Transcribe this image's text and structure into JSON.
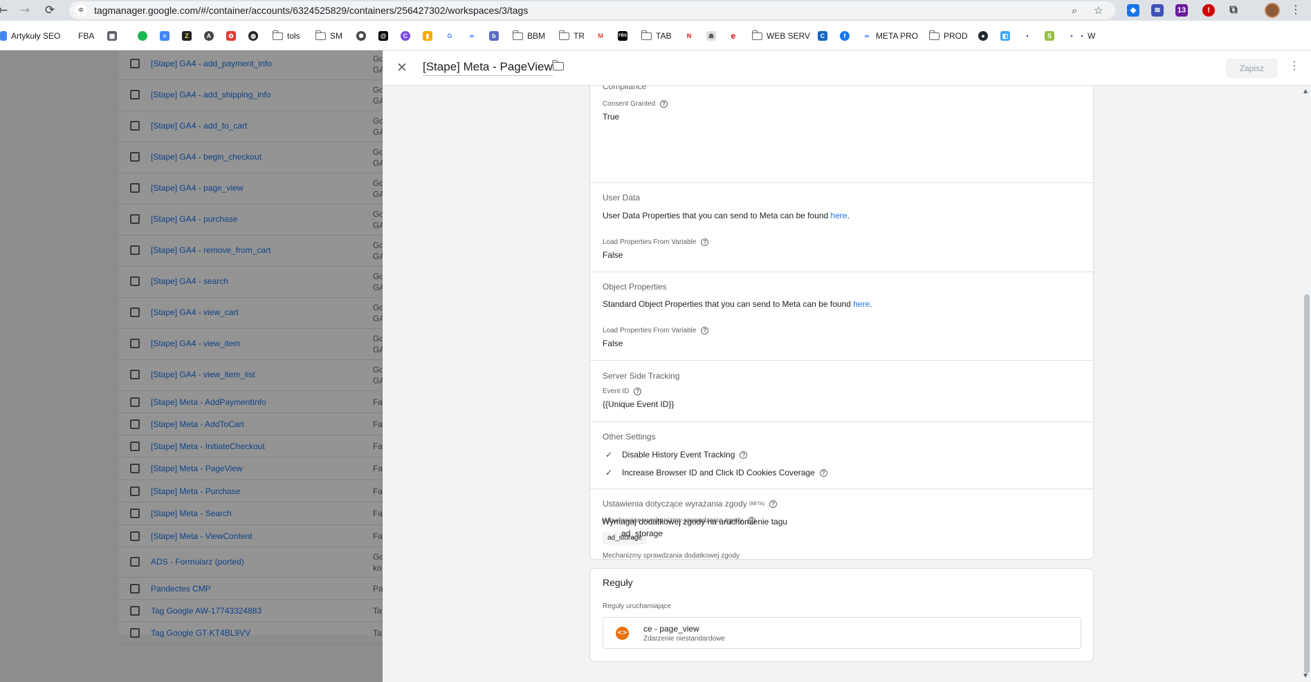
{
  "browser": {
    "url": "tagmanager.google.com/#/container/accounts/6324525829/containers/256427302/workspaces/3/tags",
    "extension_badge": "13"
  },
  "bookmarks": {
    "artykuly": "Artykuły SEO",
    "fba": "FBA",
    "tols": "tols",
    "sm": "SM",
    "bbm": "BBM",
    "tr": "TR",
    "tab": "TAB",
    "web_serv": "WEB SERV",
    "meta_pro": "META PRO",
    "prod": "PROD",
    "w": "W"
  },
  "tag_list": {
    "rows": [
      {
        "name": "[Stape] GA4 - add_payment_info",
        "type": "Go GA"
      },
      {
        "name": "[Stape] GA4 - add_shipping_info",
        "type": "Go GA"
      },
      {
        "name": "[Stape] GA4 - add_to_cart",
        "type": "Go GA"
      },
      {
        "name": "[Stape] GA4 - begin_checkout",
        "type": "Go GA"
      },
      {
        "name": "[Stape] GA4 - page_view",
        "type": "Go GA"
      },
      {
        "name": "[Stape] GA4 - purchase",
        "type": "Go GA"
      },
      {
        "name": "[Stape] GA4 - remove_from_cart",
        "type": "Go GA"
      },
      {
        "name": "[Stape] GA4 - search",
        "type": "Go GA"
      },
      {
        "name": "[Stape] GA4 - view_cart",
        "type": "Go GA"
      },
      {
        "name": "[Stape] GA4 - view_item",
        "type": "Go GA"
      },
      {
        "name": "[Stape] GA4 - view_item_list",
        "type": "Go GA"
      },
      {
        "name": "[Stape] Meta - AddPaymentInfo",
        "type": "Fa"
      },
      {
        "name": "[Stape] Meta - AddToCart",
        "type": "Fa"
      },
      {
        "name": "[Stape] Meta - InitiateCheckout",
        "type": "Fa"
      },
      {
        "name": "[Stape] Meta - PageView",
        "type": "Fa"
      },
      {
        "name": "[Stape] Meta - Purchase",
        "type": "Fa"
      },
      {
        "name": "[Stape] Meta - Search",
        "type": "Fa"
      },
      {
        "name": "[Stape] Meta - ViewContent",
        "type": "Fa"
      },
      {
        "name": "ADS - Formularz (ported)",
        "type": "Go ko"
      },
      {
        "name": "Pandectes CMP",
        "type": "Pa"
      },
      {
        "name": "Tag Google AW-17743324883",
        "type": "Ta"
      },
      {
        "name": "Tag Google GT-KT4BL9VV",
        "type": "Ta"
      }
    ]
  },
  "sheet": {
    "title": "[Stape] Meta - PageView",
    "save_label": "Zapisz"
  },
  "config": {
    "compliance_title": "Compliance",
    "consent_label": "Consent Granted",
    "consent_value": "True",
    "user_data_title": "User Data",
    "user_data_desc": "User Data Properties that you can send to Meta can be found ",
    "link_here": "here",
    "load_from_variable_label": "Load Properties From Variable",
    "user_data_load_value": "False",
    "object_props_title": "Object Properties",
    "object_props_desc": "Standard Object Properties that you can send to Meta can be found ",
    "object_props_load_value": "False",
    "sst_title": "Server Side Tracking",
    "event_id_label": "Event ID",
    "event_id_value": "{{Unique Event ID}}",
    "other_title": "Other Settings",
    "disable_history": "Disable History Event Tracking",
    "increase_cookies": "Increase Browser ID and Click ID Cookies Coverage",
    "consent_settings_title": "Ustawienia dotyczące wyrażania zgody",
    "beta": "(BETA)",
    "builtin_consent_label": "Wbudowane mechanizmy sprawdzania zgody",
    "builtin_chip": "ad_storage",
    "additional_consent_label": "Mechanizmy sprawdzania dodatkowej zgody",
    "additional_consent_value": "Wymagaj dodatkowej zgody na uruchomienie tagu",
    "additional_consent_item": "ad_storage"
  },
  "triggers": {
    "title": "Reguły",
    "subtitle": "Reguły uruchamiające",
    "trigger_name": "ce - page_view",
    "trigger_type": "Zdarzenie niestandardowe"
  }
}
